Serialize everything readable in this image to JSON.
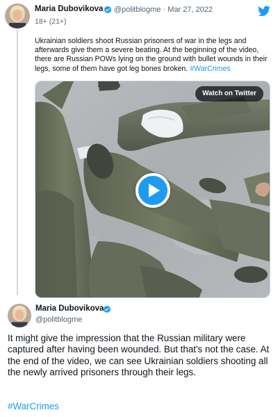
{
  "colors": {
    "link": "#1d9bf0",
    "secondary_text": "#536471",
    "primary_text": "#0f1419",
    "verified_badge": "#1d9bf0",
    "play_button": "#1d9bf0"
  },
  "icons": {
    "twitter_logo": "twitter-bird-icon",
    "verified": "verified-badge-icon",
    "play": "play-icon"
  },
  "tweet1": {
    "display_name": "Maria Dubovikova",
    "handle_and_date": "@politblogme · Mar 27, 2022",
    "age_label": "18+ (21+)",
    "text": "Ukrainian soldiers shoot Russian prisoners of war in the legs and afterwards give them a severe beating. At the beginning of the video, there are Russian POWs lying on the ground with bullet wounds in their legs, some of them have got leg bones broken.",
    "hashtag": "#WarCrimes",
    "video_button_label": "Watch on Twitter"
  },
  "tweet2": {
    "display_name": "Maria Dubovikova",
    "handle": "@politblogme",
    "text": "It might give the impression that the Russian military were captured after having been wounded. But that's not the case. At the end of the video, we can see Ukrainian soldiers shooting all the newly arrived prisoners through their legs.",
    "hashtag": "#WarCrimes"
  }
}
